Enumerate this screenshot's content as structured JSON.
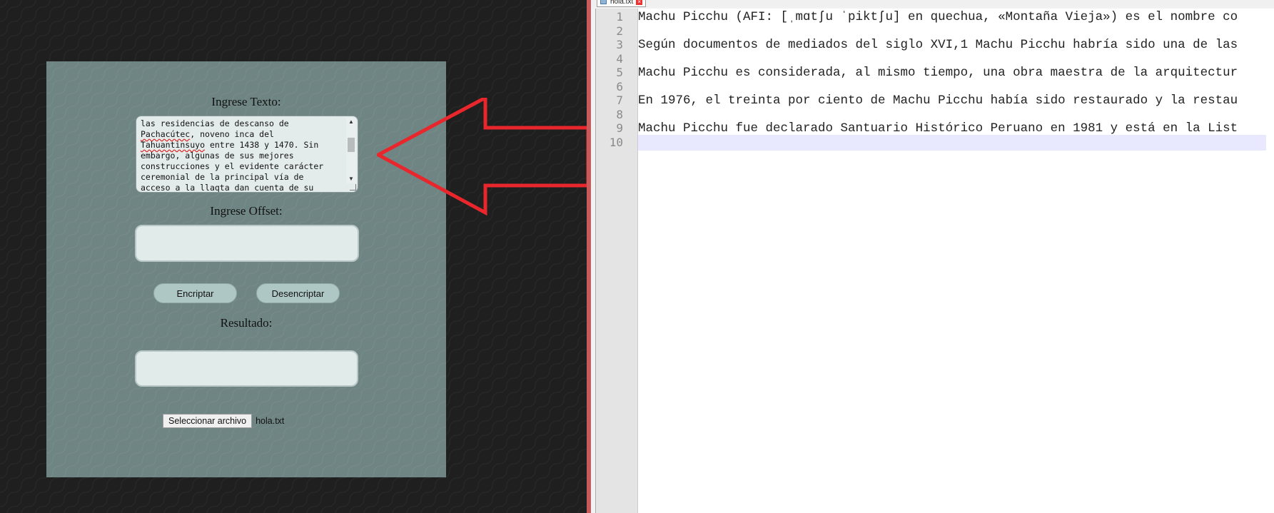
{
  "form": {
    "text_label": "Ingrese Texto:",
    "text_lines": [
      {
        "parts": [
          {
            "t": "las residencias de descanso de"
          }
        ]
      },
      {
        "parts": [
          {
            "t": "Pachacútec",
            "spell": true
          },
          {
            "t": ", noveno inca del"
          }
        ]
      },
      {
        "parts": [
          {
            "t": "Tahuantinsuyo",
            "spell": true
          },
          {
            "t": " entre 1438 y 1470. Sin"
          }
        ]
      },
      {
        "parts": [
          {
            "t": "embargo, algunas de sus mejores"
          }
        ]
      },
      {
        "parts": [
          {
            "t": "construcciones y el evidente carácter"
          }
        ]
      },
      {
        "parts": [
          {
            "t": "ceremonial de la principal vía de"
          }
        ]
      },
      {
        "parts": [
          {
            "t": "acceso a la "
          },
          {
            "t": "llaqta",
            "spell": true
          },
          {
            "t": " dan cuenta de su"
          }
        ]
      }
    ],
    "offset_label": "Ingrese Offset:",
    "offset_value": "",
    "encrypt_label": "Encriptar",
    "decrypt_label": "Desencriptar",
    "result_label": "Resultado:",
    "result_value": "",
    "file_button_label": "Seleccionar archivo",
    "file_name": "hola.txt"
  },
  "editor": {
    "tab_label": "hola.txt",
    "current_line": 10,
    "lines": [
      {
        "num": "1",
        "text": "Machu Picchu (AFI: [ˌmɑtʃu ˈpiktʃu] en quechua, «Montaña Vieja») es el nombre co"
      },
      {
        "num": "2",
        "text": ""
      },
      {
        "num": "3",
        "text": "Según documentos de mediados del siglo XVI,1 Machu Picchu habría sido una de las"
      },
      {
        "num": "4",
        "text": ""
      },
      {
        "num": "5",
        "text": "Machu Picchu es considerada, al mismo tiempo, una obra maestra de la arquitectur"
      },
      {
        "num": "6",
        "text": ""
      },
      {
        "num": "7",
        "text": "En 1976, el treinta por ciento de Machu Picchu había sido restaurado y la restau"
      },
      {
        "num": "8",
        "text": ""
      },
      {
        "num": "9",
        "text": "Machu Picchu fue declarado Santuario Histórico Peruano en 1981 y está en la List"
      },
      {
        "num": "10",
        "text": ""
      }
    ]
  },
  "colors": {
    "arrow": "#e8262b",
    "panel": "#6f8584",
    "button": "#aec6c4"
  }
}
